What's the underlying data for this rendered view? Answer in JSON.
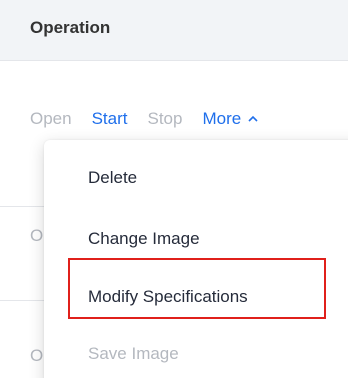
{
  "table": {
    "column_header": "Operation"
  },
  "actions": {
    "open": "Open",
    "start": "Start",
    "stop": "Stop",
    "more": "More"
  },
  "row_stubs": [
    "O",
    "O"
  ],
  "dropdown": {
    "items": [
      {
        "label": "Delete",
        "enabled": true
      },
      {
        "label": "Change Image",
        "enabled": true
      },
      {
        "label": "Modify Specifications",
        "enabled": true,
        "highlighted": true
      },
      {
        "label": "Save Image",
        "enabled": false
      }
    ]
  },
  "colors": {
    "link": "#1f6feb",
    "disabled": "#b4b8bf",
    "highlight": "#e0201b",
    "header_bg": "#f2f4f7"
  }
}
